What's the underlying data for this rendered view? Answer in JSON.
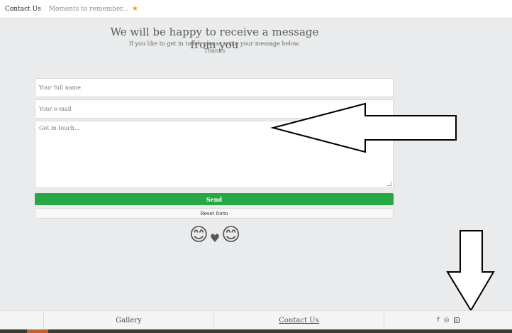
{
  "nav": {
    "contact_label": "Contact Us",
    "moments_label": "Moments to remember...",
    "star_icon": "★"
  },
  "form": {
    "heading": "We will be happy to receive a message from you",
    "subtitle_line1": "If you like to get in touch please write your message below.",
    "subtitle_line2": "Thanks",
    "name_placeholder": "Your full name",
    "email_placeholder": "Your e-mail",
    "message_placeholder": "Get in touch...",
    "send_label": "Send",
    "reset_label": "Reset form"
  },
  "decor": {
    "emoji_left": "😊",
    "heart": "♥",
    "emoji_right": "😊"
  },
  "footer": {
    "gallery_label": "Gallery",
    "contact_label": "Contact Us",
    "social": {
      "facebook": "f",
      "instagram": "◎",
      "linkedin": "in"
    }
  },
  "colors": {
    "send_button": "#28a745",
    "background": "#e9ebec"
  }
}
